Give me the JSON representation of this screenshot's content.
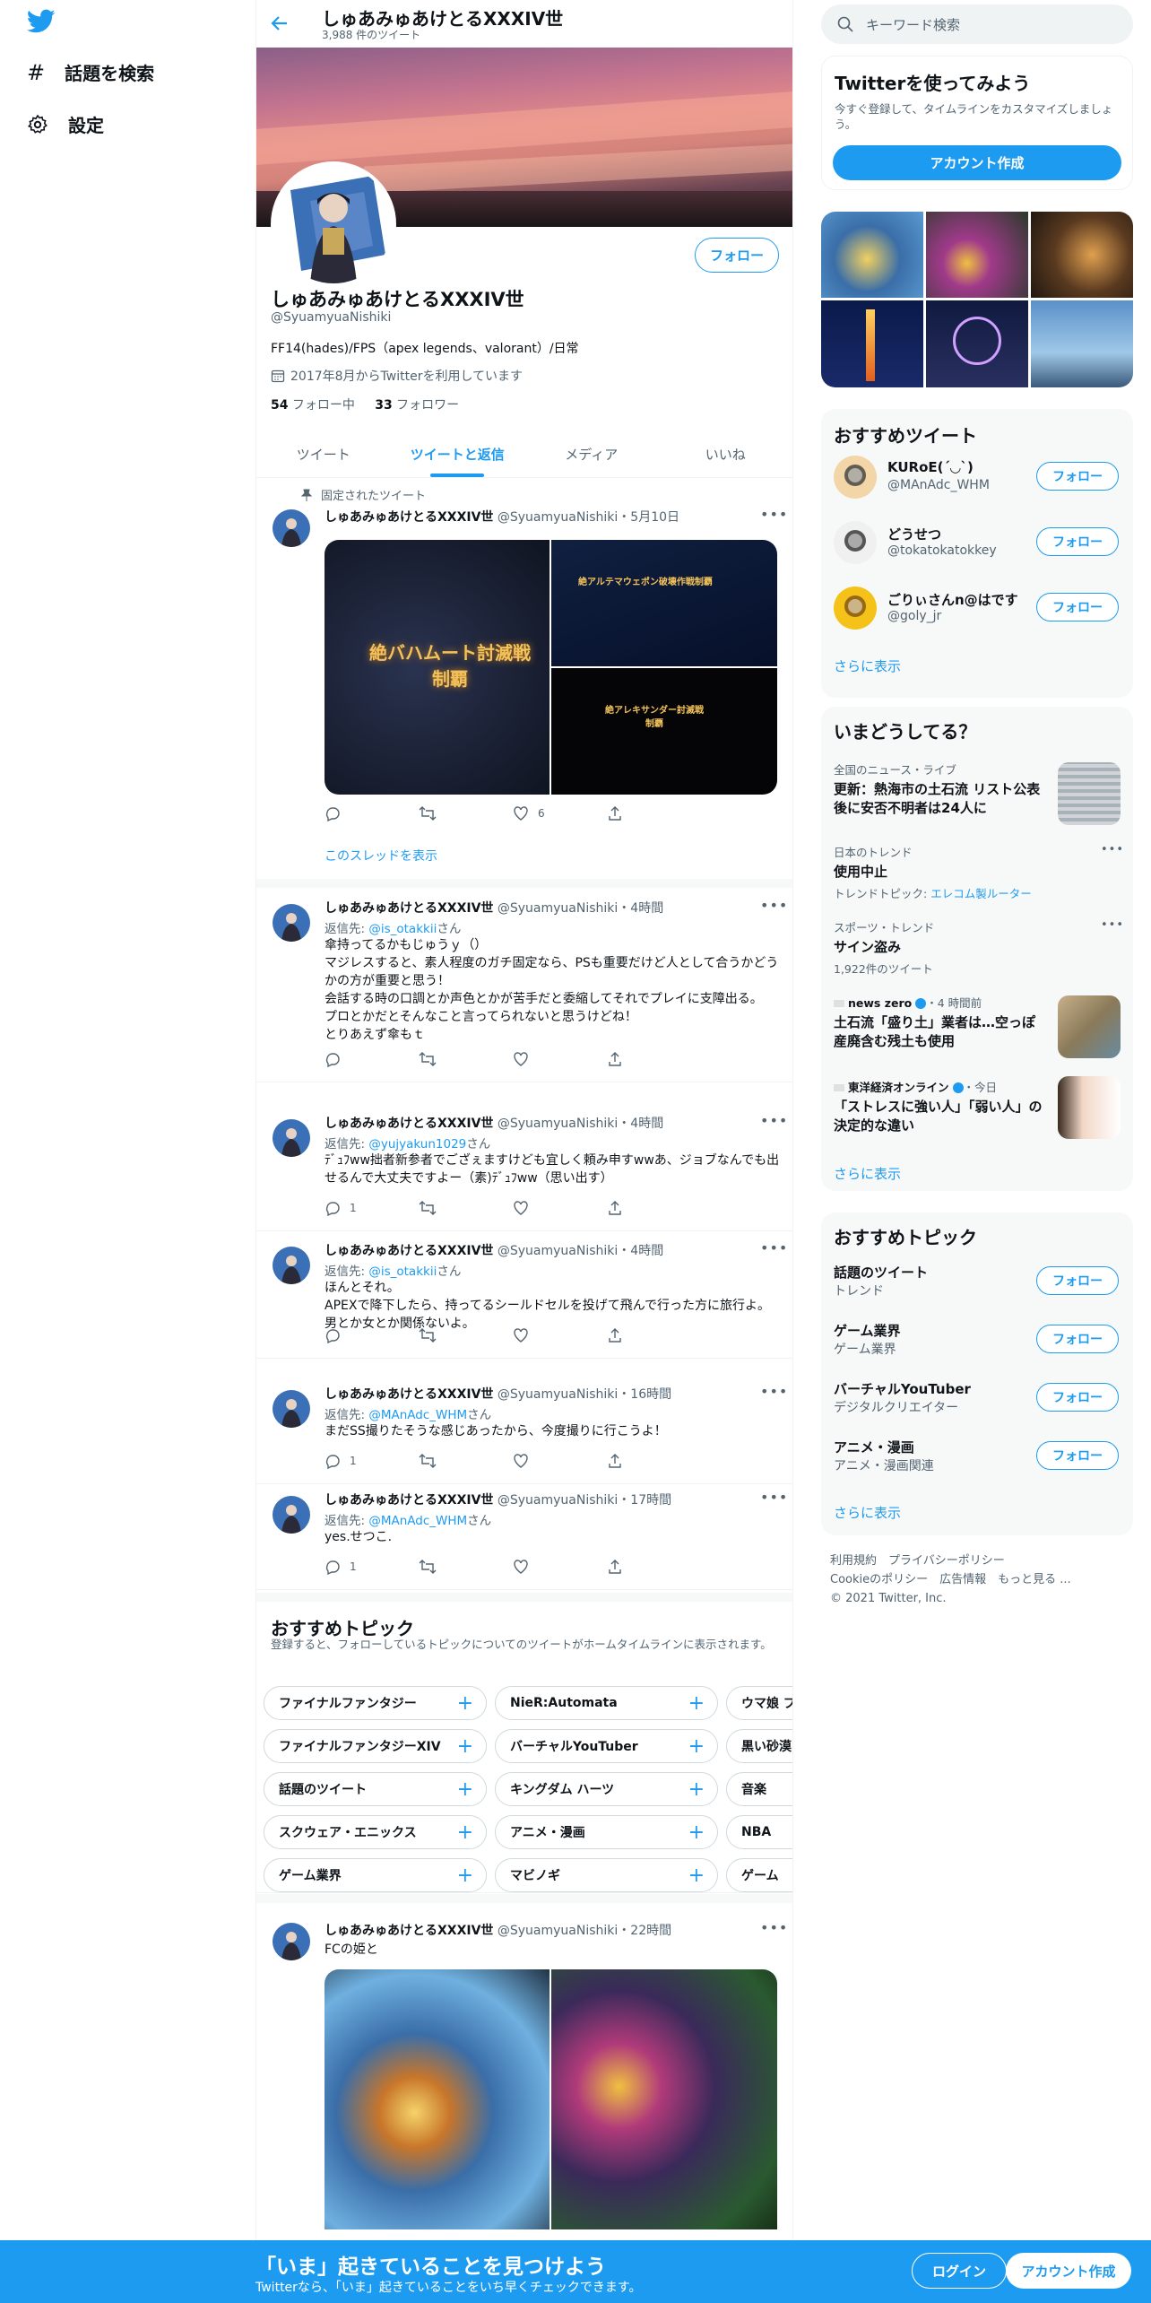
{
  "nav": {
    "explore": "話題を検索",
    "settings": "設定"
  },
  "header": {
    "name": "しゅあみゅあけとるXXXIV世",
    "count": "3,988 件のツイート"
  },
  "profile": {
    "follow": "フォロー",
    "name": "しゅあみゅあけとるXXXIV世",
    "handle": "@SyuamyuaNishiki",
    "bio": "FF14(hades)/FPS（apex legends、valorant）/日常",
    "joined": "2017年8月からTwitterを利用しています",
    "following_count": "54",
    "following_label": " フォロー中",
    "followers_count": "33",
    "followers_label": " フォロワー"
  },
  "tabs": [
    "ツイート",
    "ツイートと返信",
    "メディア",
    "いいね"
  ],
  "pinned": {
    "label": "固定されたツイート",
    "name": "しゅあみゅあけとるXXXIV世",
    "meta": " @SyuamyuaNishiki・5月10日",
    "img1": "絶バハムート討滅戦\n制覇",
    "img2": "絶アルテマウェポン破壊作戦制覇",
    "img3": "絶アレキサンダー討滅戦\n制覇",
    "likes": "6",
    "thread": "このスレッドを表示"
  },
  "tweets": [
    {
      "name": "しゅあみゅあけとるXXXIV世",
      "meta": " @SyuamyuaNishiki・4時間",
      "reply_prefix": "返信先: ",
      "reply_to": "@is_otakkii",
      "reply_suffix": "さん",
      "text": "傘持ってるかもじゅうｙ（）\nマジレスすると、素人程度のガチ固定なら、PSも重要だけど人として合うかどうかの方が重要と思う！\n会話する時の口調とか声色とかが苦手だと委縮してそれでプレイに支障出る。\nプロとかだとそんなこと言ってられないと思うけどね！\nとりあえず傘もｔ",
      "replies": ""
    },
    {
      "name": "しゅあみゅあけとるXXXIV世",
      "meta": " @SyuamyuaNishiki・4時間",
      "reply_prefix": "返信先: ",
      "reply_to": "@yujyakun1029",
      "reply_suffix": "さん",
      "text": "ﾃﾞｭﾌww拙者新参者でござぇますけども宜しく頼み申すwwあ、ジョブなんでも出せるんで大丈夫ですよー（素)ﾃﾞｭﾌww（思い出す）",
      "replies": "1"
    },
    {
      "name": "しゅあみゅあけとるXXXIV世",
      "meta": " @SyuamyuaNishiki・4時間",
      "reply_prefix": "返信先: ",
      "reply_to": "@is_otakkii",
      "reply_suffix": "さん",
      "text": "ほんとそれ。\nAPEXで降下したら、持ってるシールドセルを投げて飛んで行った方に旅行よ。男とか女とか関係ないよ。",
      "replies": ""
    },
    {
      "name": "しゅあみゅあけとるXXXIV世",
      "meta": " @SyuamyuaNishiki・16時間",
      "reply_prefix": "返信先: ",
      "reply_to": "@MAnAdc_WHM",
      "reply_suffix": "さん",
      "text": "まだSS撮りたそうな感じあったから、今度撮りに行こうよ！",
      "replies": "1"
    },
    {
      "name": "しゅあみゅあけとるXXXIV世",
      "meta": " @SyuamyuaNishiki・17時間",
      "reply_prefix": "返信先: ",
      "reply_to": "@MAnAdc_WHM",
      "reply_suffix": "さん",
      "text": "yes.せつこ.",
      "replies": "1"
    }
  ],
  "topics": {
    "title": "おすすめトピック",
    "desc": "登録すると、フォローしているトピックについてのツイートがホームタイムラインに表示されます。",
    "rows": [
      [
        "ファイナルファンタジー",
        "NieR:Automata",
        "ウマ娘 プリティ"
      ],
      [
        "ファイナルファンタジーXIV",
        "バーチャルYouTuber",
        "黒い砂漠"
      ],
      [
        "話題のツイート",
        "キングダム ハーツ",
        "音楽"
      ],
      [
        "スクウェア・エニックス",
        "アニメ・漫画",
        "NBA"
      ],
      [
        "ゲーム業界",
        "マビノギ",
        "ゲーム"
      ]
    ]
  },
  "last_tweet": {
    "name": "しゅあみゅあけとるXXXIV世",
    "meta": " @SyuamyuaNishiki・22時間",
    "text": "FCの姫と"
  },
  "search": {
    "placeholder": "キーワード検索"
  },
  "signup_box": {
    "title": "Twitterを使ってみよう",
    "desc": "今すぐ登録して、タイムラインをカスタマイズしましょう。",
    "button": "アカウント作成"
  },
  "recommended": {
    "title": "おすすめツイート",
    "users": [
      {
        "name": "KURoE(´◡`)",
        "handle": "@MAnAdc_WHM"
      },
      {
        "name": "どうせつ",
        "handle": "@tokatokatokkey"
      },
      {
        "name": "ごりぃさんn@はです",
        "handle": "@goly_jr"
      }
    ],
    "follow": "フォロー",
    "more": "さらに表示"
  },
  "trends": {
    "title": "いまどうしてる？",
    "items": [
      {
        "meta": "全国のニュース・ライブ",
        "title": "更新：熱海市の土石流 リスト公表後に安否不明者は24人に"
      },
      {
        "meta": "日本のトレンド",
        "title": "使用中止",
        "sub_prefix": "トレンドトピック: ",
        "sub_link": "エレコム製ルーター"
      },
      {
        "meta": "スポーツ・トレンド",
        "title": "サイン盗み",
        "sub": "1,922件のツイート"
      },
      {
        "source": "news zero",
        "time": "・4 時間前",
        "title": "土石流「盛り土」業者は…空っぽ　産廃含む残土も使用"
      },
      {
        "source": "東洋経済オンライン",
        "time": "・今日",
        "title": "「ストレスに強い人」「弱い人」の決定的な違い"
      }
    ],
    "more": "さらに表示"
  },
  "topics_right": {
    "title": "おすすめトピック",
    "items": [
      {
        "name": "話題のツイート",
        "cat": "トレンド"
      },
      {
        "name": "ゲーム業界",
        "cat": "ゲーム業界"
      },
      {
        "name": "バーチャルYouTuber",
        "cat": "デジタルクリエイター"
      },
      {
        "name": "アニメ・漫画",
        "cat": "アニメ・漫画関連"
      }
    ],
    "follow": "フォロー",
    "more": "さらに表示"
  },
  "footer": {
    "l1": "利用規約　プライバシーポリシー",
    "l2": "Cookieのポリシー　広告情報　もっと見る ...",
    "l3": "© 2021 Twitter, Inc."
  },
  "bottom": {
    "title": "「いま」起きていることを見つけよう",
    "sub": "Twitterなら、「いま」起きていることをいち早くチェックできます。",
    "login": "ログイン",
    "signup": "アカウント作成"
  },
  "colors": {
    "accent": "#1d9bf0",
    "text": "#0f1419",
    "muted": "#536471"
  }
}
